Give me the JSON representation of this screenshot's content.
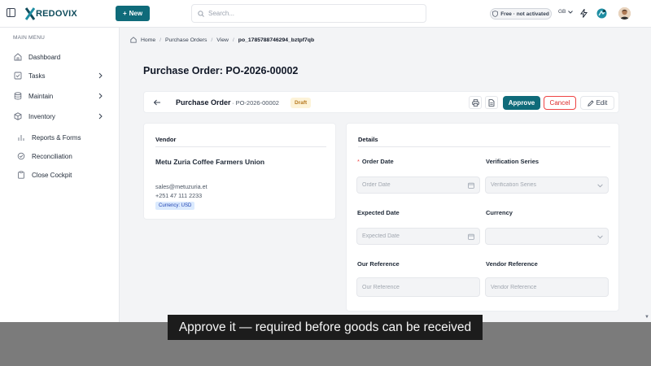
{
  "app": {
    "brand": "REDOVIX",
    "new_label": "New",
    "search_placeholder": "Search...",
    "plan_badge": "Free · not activated",
    "language": "GB"
  },
  "sidebar": {
    "heading": "MAIN MENU",
    "items": [
      {
        "label": "Dashboard",
        "icon": "home-icon"
      },
      {
        "label": "Tasks",
        "icon": "checkbox-icon"
      },
      {
        "label": "Maintain",
        "icon": "database-icon"
      },
      {
        "label": "Inventory",
        "icon": "box-icon"
      }
    ],
    "sub_items": [
      {
        "label": "Reports & Forms",
        "icon": "bar-chart-icon"
      },
      {
        "label": "Reconciliation",
        "icon": "check-circle-icon"
      },
      {
        "label": "Close Cockpit",
        "icon": "clipboard-icon"
      }
    ]
  },
  "breadcrumb": {
    "home": "Home",
    "section": "Purchase Orders",
    "view": "View",
    "current": "po_1785788746294_bztpf7qb"
  },
  "page": {
    "title": "Purchase Order: PO-2026-00002"
  },
  "order_header": {
    "title": "Purchase Order",
    "number": "· PO-2026-00002",
    "status": "Draft",
    "approve_label": "Approve",
    "cancel_label": "Cancel",
    "edit_label": "Edit"
  },
  "vendor": {
    "heading": "Vendor",
    "name": "Metu Zuria Coffee Farmers Union",
    "email": "sales@metuzuria.et",
    "phone": "+251 47 111 2233",
    "currency": "Currency: USD"
  },
  "details": {
    "heading": "Details",
    "order_date_label": "Order Date",
    "order_date_placeholder": "Order Date",
    "verification_series_label": "Verification Series",
    "verification_series_placeholder": "Verification Series",
    "expected_date_label": "Expected Date",
    "expected_date_placeholder": "Expected Date",
    "currency_label": "Currency",
    "our_reference_label": "Our Reference",
    "our_reference_placeholder": "Our Reference",
    "vendor_reference_label": "Vendor Reference",
    "vendor_reference_placeholder": "Vendor Reference"
  },
  "caption": {
    "text": "Approve it — required before goods can be received"
  },
  "colors": {
    "brand": "#0f6b7a",
    "danger": "#dc2626",
    "draft_bg": "#fdf3d8",
    "draft_text": "#b7791f"
  }
}
